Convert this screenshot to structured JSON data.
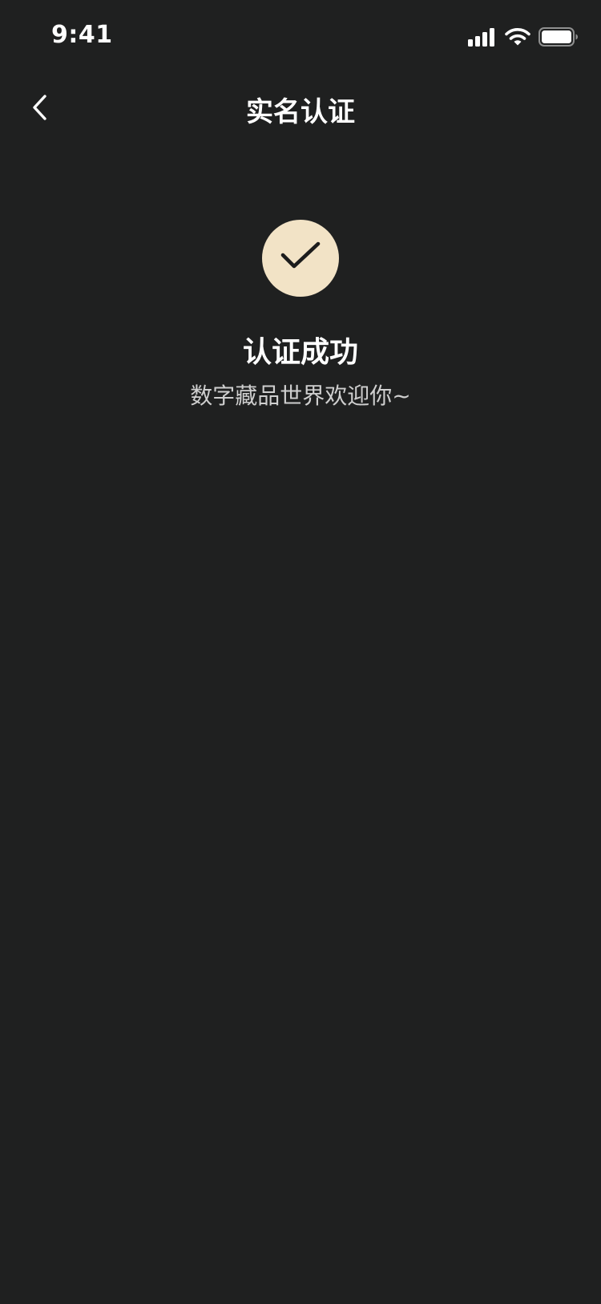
{
  "status_bar": {
    "time": "9:41",
    "icons": [
      "cellular-signal-icon",
      "wifi-icon",
      "battery-icon"
    ]
  },
  "nav": {
    "back_icon": "chevron-left-icon",
    "title": "实名认证"
  },
  "result": {
    "icon": "check-icon",
    "title": "认证成功",
    "subtitle": "数字藏品世界欢迎你~"
  },
  "colors": {
    "background": "#1f2020",
    "badge": "#f2e3c6",
    "check": "#1c1c1c",
    "subtitle": "#cfcfcf"
  }
}
